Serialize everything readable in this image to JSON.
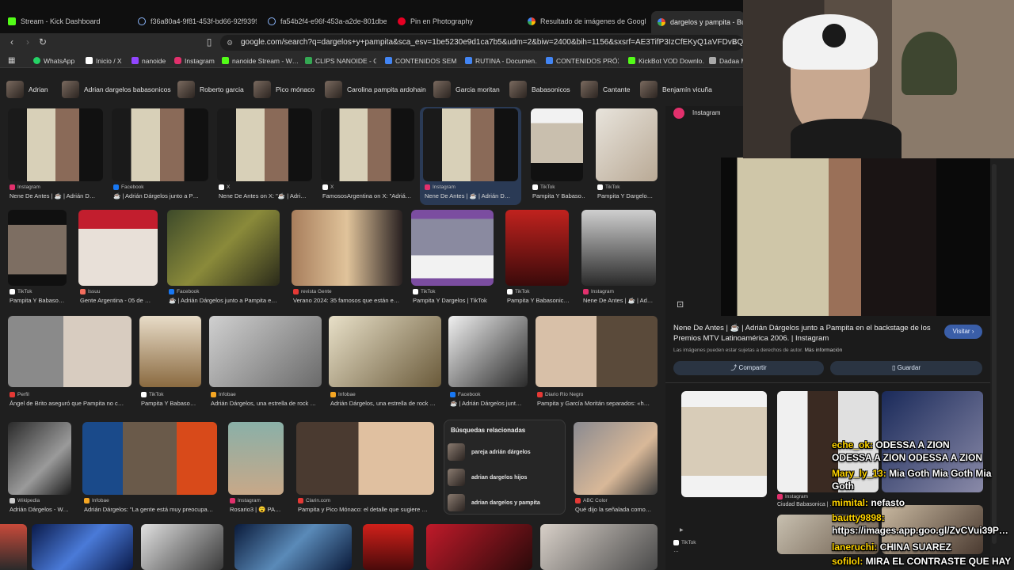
{
  "tabs": [
    {
      "label": "Stream - Kick Dashboard",
      "color": "#53fc18"
    },
    {
      "label": "f36a80a4-9f81-453f-bd66-92f93998…",
      "color": "#8ab4f8"
    },
    {
      "label": "fa54b2f4-e96f-453a-a2de-801dbe60…",
      "color": "#8ab4f8"
    },
    {
      "label": "Pin en Photography",
      "color": "#e60023"
    },
    {
      "label": "Resultado de imágenes de Google",
      "color": "#4285f4"
    },
    {
      "label": "dargelos y pampita - Busca…",
      "color": "#4285f4"
    }
  ],
  "address": {
    "url": "google.com/search?q=dargelos+y+pampita&sca_esv=1be5230e9d1ca7b5&udm=2&biw=2400&bih=1156&sxsrf=AE3TifP3IzCfEKyQ1aVFDvBQ…"
  },
  "bookmarks": [
    {
      "label": "WhatsApp",
      "color": "#25d366"
    },
    {
      "label": "Inicio / X",
      "color": "#ffffff"
    },
    {
      "label": "nanoide",
      "color": "#9146ff"
    },
    {
      "label": "Instagram",
      "color": "#e1306c"
    },
    {
      "label": "nanoide Stream - W…",
      "color": "#53fc18"
    },
    {
      "label": "CLIPS NANOIDE - G…",
      "color": "#34a853"
    },
    {
      "label": "CONTENIDOS SEM…",
      "color": "#4285f4"
    },
    {
      "label": "RUTINA - Documen…",
      "color": "#4285f4"
    },
    {
      "label": "CONTENIDOS PRÓX…",
      "color": "#4285f4"
    },
    {
      "label": "KickBot VOD Downlo…",
      "color": "#53fc18"
    },
    {
      "label": "Dadaa M…",
      "color": "#cccccc"
    }
  ],
  "chips": [
    "Adrian",
    "Adrian dargelos babasonicos",
    "Roberto garcia",
    "Pico mónaco",
    "Carolina pampita ardohain",
    "Garcia moritan",
    "Babasonicos",
    "Cantante",
    "Benjamín vicuña"
  ],
  "grid_rows": [
    {
      "items": [
        {
          "source": "Instagram",
          "title": "Nene De Antes | ☕ | Adrián D…",
          "color": "#e1306c"
        },
        {
          "source": "Facebook",
          "title": "☕ | Adrián Dárgelos junto a P…",
          "color": "#1877f2"
        },
        {
          "source": "X",
          "title": "Nene De Antes on X: \"☕ | Adri…",
          "color": "#ffffff"
        },
        {
          "source": "X",
          "title": "FamososArgentina on X: \"Adriá…",
          "color": "#ffffff"
        },
        {
          "source": "Instagram",
          "title": "Nene De Antes | ☕ | Adrián D…",
          "color": "#e1306c"
        },
        {
          "source": "TikTok",
          "title": "Pampita Y Babaso…",
          "color": "#ffffff"
        },
        {
          "source": "TikTok",
          "title": "Pampita Y Dargelo…",
          "color": "#ffffff"
        }
      ]
    },
    {
      "items": [
        {
          "source": "TikTok",
          "title": "Pampita Y Babaso…",
          "color": "#ffffff"
        },
        {
          "source": "Issuu",
          "title": "Gente Argentina - 05 de …",
          "color": "#f36d5d"
        },
        {
          "source": "Facebook",
          "title": "☕ | Adrián Dárgelos junto a Pampita e…",
          "color": "#1877f2"
        },
        {
          "source": "revista Gente",
          "title": "Verano 2024: 35 famosos que están e…",
          "color": "#e53935"
        },
        {
          "source": "TikTok",
          "title": "Pampita Y Dargelos | TikTok",
          "color": "#ffffff"
        },
        {
          "source": "TikTok",
          "title": "Pampita Y Babasonic…",
          "color": "#ffffff"
        },
        {
          "source": "Instagram",
          "title": "Nene De Antes | ☕ | Ad…",
          "color": "#e1306c"
        }
      ]
    },
    {
      "items": [
        {
          "source": "Perfil",
          "title": "Ángel de Brito aseguró que Pampita no c…",
          "color": "#e53935"
        },
        {
          "source": "TikTok",
          "title": "Pampita Y Babaso…",
          "color": "#ffffff"
        },
        {
          "source": "Infobae",
          "title": "Adrián Dárgelos, una estrella de rock …",
          "color": "#f5a623"
        },
        {
          "source": "Infobae",
          "title": "Adrián Dárgelos, una estrella de rock …",
          "color": "#f5a623"
        },
        {
          "source": "Facebook",
          "title": "☕ | Adrián Dárgelos junt…",
          "color": "#1877f2"
        },
        {
          "source": "Diario Río Negro",
          "title": "Pampita y García Moritán separados: «h…",
          "color": "#e53935"
        }
      ]
    },
    {
      "items": [
        {
          "source": "Wikipedia",
          "title": "Adrián Dárgelos - W…",
          "color": "#cccccc"
        },
        {
          "source": "Infobae",
          "title": "Adrián Dárgelos: \"La gente está muy preocupa…",
          "color": "#f5a623"
        },
        {
          "source": "Instagram",
          "title": "Rosario3 | 😮 PA…",
          "color": "#e1306c"
        },
        {
          "source": "Clarin.com",
          "title": "Pampita y Pico Mónaco: el detalle que sugiere …",
          "color": "#e53935"
        },
        {
          "source": "ABC Color",
          "title": "Qué dijo la señalada como…",
          "color": "#e53935"
        }
      ]
    }
  ],
  "related": {
    "heading": "Búsquedas relacionadas",
    "items": [
      "pareja adrián dárgelos",
      "adrian dargelos hijos",
      "adrian dargelos y pampita"
    ]
  },
  "panel": {
    "source": "Instagram",
    "title": "Nene De Antes | ☕ | Adrián Dárgelos junto a Pampita en el backstage de los Premios MTV Latinoamérica 2006. | Instagram",
    "visit": "Visitar",
    "copyright": "Las imágenes pueden estar sujetas a derechos de autor.",
    "more_info": "Más información",
    "share": "Compartir",
    "save": "Guardar",
    "related_sources": [
      {
        "source": "TikTok",
        "title": "…",
        "color": "#ffffff"
      },
      {
        "source": "Instagram",
        "title": "Ciudad Babasonica | …",
        "color": "#e1306c"
      }
    ]
  },
  "chat": [
    {
      "user": "eche_ok:",
      "text": "ODESSA A ZION ODESSA A ZION ODESSA A ZION"
    },
    {
      "user": "Mary_ly_13:",
      "text": "Mia Goth Mia Goth Mia Goth"
    },
    {
      "user": "mimital:",
      "text": "nefasto"
    },
    {
      "user": "bautty9898:",
      "text": "https://images.app.goo.gl/ZvCVui39P…"
    },
    {
      "user": "laneruchi:",
      "text": "CHINA SUAREZ"
    },
    {
      "user": "sofilol:",
      "text": "MIRA EL CONTRASTE QUE HAY"
    }
  ]
}
